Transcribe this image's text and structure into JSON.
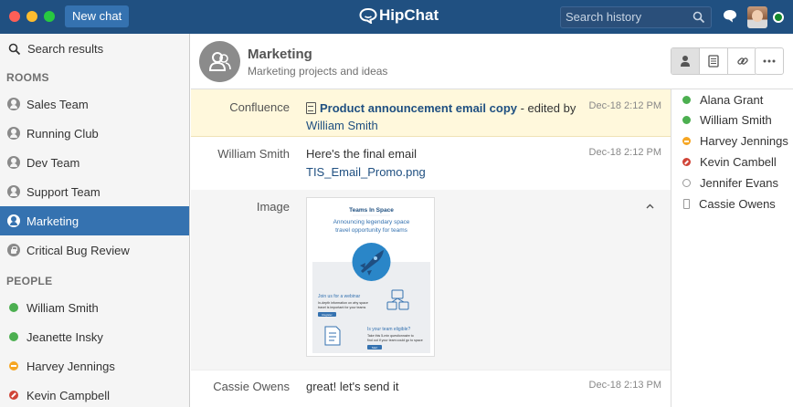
{
  "app": {
    "brand": "HipChat",
    "new_chat_label": "New chat",
    "search_placeholder": "Search history"
  },
  "sidebar": {
    "search_label": "Search results",
    "rooms_heading": "ROOMS",
    "rooms": [
      {
        "label": "Sales Team",
        "icon": "room-icon"
      },
      {
        "label": "Running Club",
        "icon": "room-icon"
      },
      {
        "label": "Dev Team",
        "icon": "room-icon"
      },
      {
        "label": "Support Team",
        "icon": "room-icon"
      },
      {
        "label": "Marketing",
        "icon": "room-icon",
        "active": true
      },
      {
        "label": "Critical Bug Review",
        "icon": "lock-icon"
      }
    ],
    "people_heading": "PEOPLE",
    "people": [
      {
        "label": "William Smith",
        "status": "available"
      },
      {
        "label": "Jeanette Insky",
        "status": "available"
      },
      {
        "label": "Harvey Jennings",
        "status": "away"
      },
      {
        "label": "Kevin Campbell",
        "status": "dnd"
      }
    ]
  },
  "room": {
    "name": "Marketing",
    "topic": "Marketing projects and ideas"
  },
  "messages": [
    {
      "sender": "Confluence",
      "doc_title": "Product announcement email copy",
      "edited_by_text": " - edited by",
      "editor": "William Smith",
      "time": "Dec-18 2:12 PM"
    },
    {
      "sender": "William Smith",
      "text": "Here's the final email",
      "file": "TIS_Email_Promo.png",
      "time": "Dec-18 2:12 PM"
    },
    {
      "sender": "Image",
      "preview": {
        "brand": "Teams In Space",
        "headline": "Announcing legendary space travel opportunity for teams",
        "webinar_title": "Join us for a webinar",
        "webinar_text": "In-depth information on why space travel is important for your teams",
        "webinar_btn": "Register",
        "eligible_title": "Is your team eligible?",
        "eligible_text": "Take this 5-min questionnaire to find out if your team could go to space",
        "eligible_btn": "Start"
      }
    },
    {
      "sender": "Cassie Owens",
      "text": "great! let's send it",
      "time": "Dec-18 2:13 PM"
    }
  ],
  "roster": [
    {
      "name": "Alana Grant",
      "status": "available"
    },
    {
      "name": "William Smith",
      "status": "available"
    },
    {
      "name": "Harvey Jennings",
      "status": "away"
    },
    {
      "name": "Kevin Cambell",
      "status": "dnd"
    },
    {
      "name": "Jennifer Evans",
      "status": "offline"
    },
    {
      "name": "Cassie Owens",
      "status": "mobile"
    }
  ],
  "colors": {
    "titlebar": "#205081",
    "accent": "#3572b0",
    "available": "#4caf50",
    "away": "#f6a623",
    "dnd": "#d04437",
    "highlight_row": "#fff8dc"
  }
}
